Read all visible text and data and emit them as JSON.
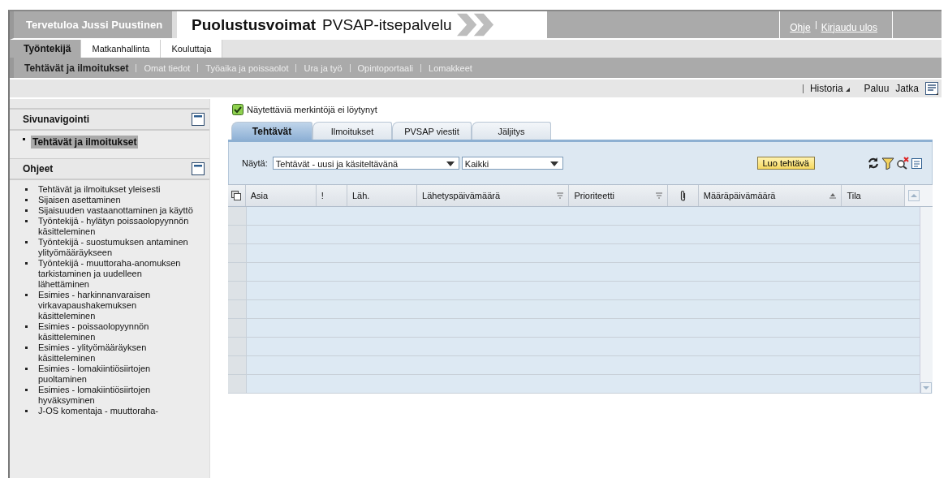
{
  "header": {
    "welcome": "Tervetuloa Jussi Puustinen",
    "brand": "Puolustusvoimat",
    "app": "PVSAP-itsepalvelu",
    "links": [
      "Ohje",
      "Kirjaudu ulos"
    ]
  },
  "top_tabs": [
    {
      "label": "Työntekijä",
      "selected": true
    },
    {
      "label": "Matkanhallinta",
      "selected": false
    },
    {
      "label": "Kouluttaja",
      "selected": false
    }
  ],
  "sub_nav": [
    {
      "label": "Tehtävät ja ilmoitukset",
      "selected": true
    },
    {
      "label": "Omat tiedot",
      "selected": false
    },
    {
      "label": "Työaika ja poissaolot",
      "selected": false
    },
    {
      "label": "Ura ja työ",
      "selected": false
    },
    {
      "label": "Opintoportaali",
      "selected": false
    },
    {
      "label": "Lomakkeet",
      "selected": false
    }
  ],
  "toolbar": {
    "history": "Historia",
    "back": "Paluu",
    "forward": "Jatka"
  },
  "sidebar": {
    "navigation": {
      "title": "Sivunavigointi",
      "items": [
        {
          "label": "Tehtävät ja ilmoitukset",
          "selected": true
        }
      ]
    },
    "help": {
      "title": "Ohjeet",
      "items": [
        "Tehtävät ja ilmoitukset yleisesti",
        "Sijaisen asettaminen",
        "Sijaisuuden vastaanottaminen ja käyttö",
        "Työntekijä - hylätyn poissaolopyynnön käsitteleminen",
        "Työntekijä - suostumuksen antaminen ylityömääräykseen",
        "Työntekijä - muuttoraha-anomuksen tarkistaminen ja uudelleen lähettäminen",
        "Esimies - harkinnanvaraisen virkavapaushakemuksen käsitteleminen",
        "Esimies - poissaolopyynnön käsitteleminen",
        "Esimies - ylityömääräyksen käsitteleminen",
        "Esimies - lomakiintiösiirtojen puoltaminen",
        "Esimies - lomakiintiösiirtojen hyväksyminen",
        "J-OS komentaja - muuttoraha-"
      ]
    }
  },
  "message": {
    "text": "Näytettäviä merkintöjä ei löytynyt",
    "checked": true
  },
  "tabs": [
    {
      "label": "Tehtävät",
      "selected": true
    },
    {
      "label": "Ilmoitukset",
      "selected": false
    },
    {
      "label": "PVSAP viestit",
      "selected": false
    },
    {
      "label": "Jäljitys",
      "selected": false
    }
  ],
  "filter": {
    "label": "Näytä:",
    "type": "Tehtävät - uusi ja käsiteltävänä",
    "scope": "Kaikki",
    "button": "Luo tehtävä"
  },
  "table": {
    "columns": [
      {
        "label": "Asia",
        "kind": "text"
      },
      {
        "label": "!",
        "kind": "text"
      },
      {
        "label": "Läh.",
        "kind": "text"
      },
      {
        "label": "Lähetyspäivämäärä",
        "kind": "text",
        "filterable": true
      },
      {
        "label": "Prioriteetti",
        "kind": "text",
        "filterable": true
      },
      {
        "kind": "attachment"
      },
      {
        "label": "Määräpäivämäärä",
        "kind": "text",
        "sorted": true
      },
      {
        "label": "Tila",
        "kind": "text"
      }
    ]
  }
}
